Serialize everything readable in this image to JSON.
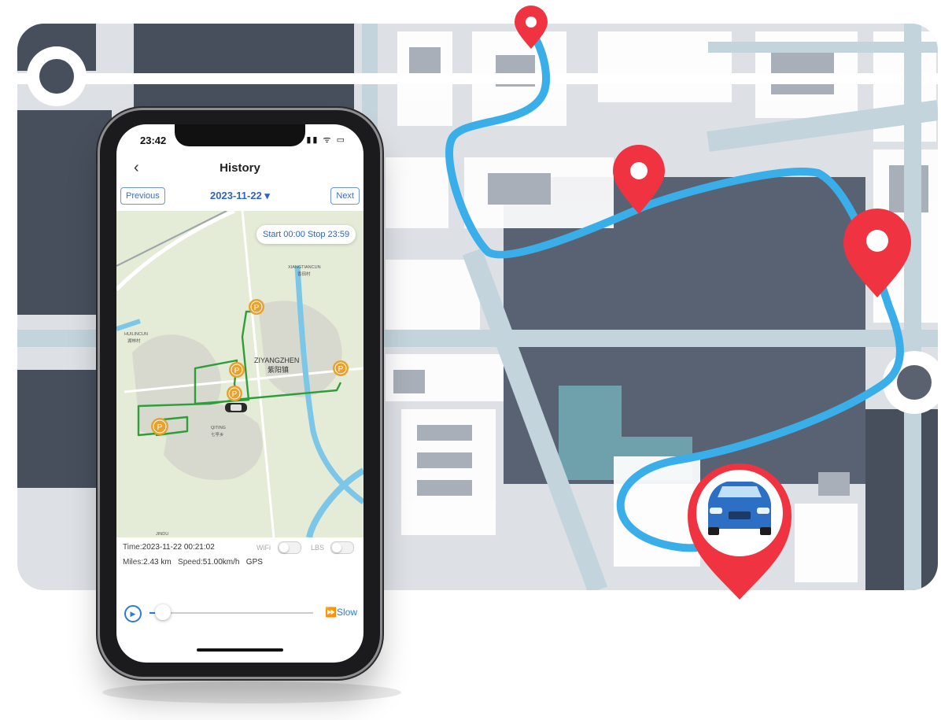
{
  "status_bar": {
    "time": "23:42",
    "icons": "▮▮ ᯤ ▭"
  },
  "header": {
    "back_icon": "chevron-left-icon",
    "title": "History"
  },
  "date_nav": {
    "previous": "Previous",
    "date": "2023-11-22 ▾",
    "next": "Next"
  },
  "map": {
    "time_range": "Start 00:00 Stop 23:59",
    "labels": {
      "ziyang_pinyin": "ZIYANGZHEN",
      "ziyang_cn": "紫阳镇",
      "xiangtiancun": "XIANGTIANCUN",
      "xiangtiancun_cn": "香田村",
      "huilincun": "HUILINCUN",
      "huilincun_cn": "湖林村",
      "qiting": "QITING",
      "qiting_cn": "七亭乡",
      "jindu": "JINDU"
    },
    "parking_label": "P"
  },
  "info": {
    "time_label": "Time:",
    "time_value": "2023-11-22 00:21:02",
    "wifi_label": "WiFi",
    "lbs_label": "LBS",
    "miles_label": "Miles:",
    "miles_value": "2.43 km",
    "speed_label": "Speed:",
    "speed_value": "51.00km/h",
    "mode": "GPS"
  },
  "playback": {
    "play_icon": "play-icon",
    "progress": 0.08,
    "speed_label": "Slow",
    "speed_icon": "fast-forward-icon"
  },
  "colors": {
    "accent": "#2f63c5",
    "track": "#2e9e3a",
    "parking": "#e8a12c",
    "route": "#3aaee8",
    "pin": "#ef3340"
  }
}
